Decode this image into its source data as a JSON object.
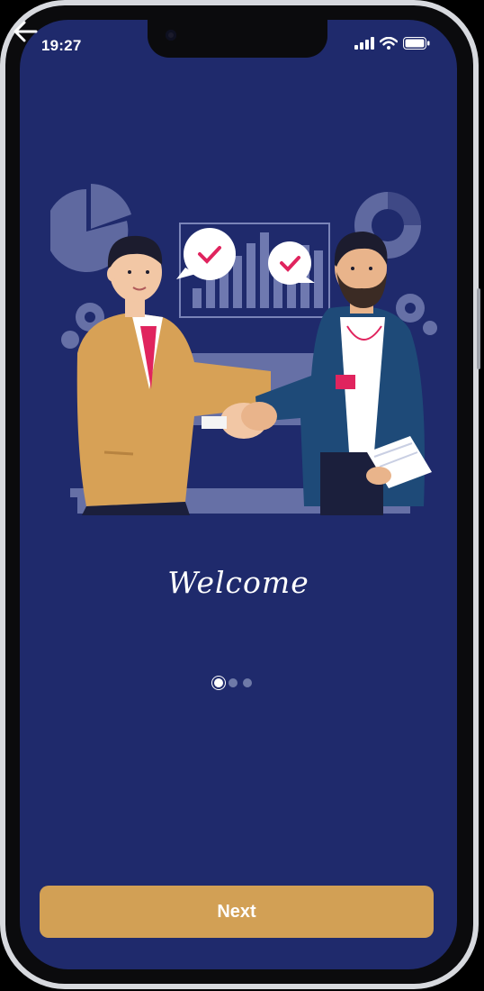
{
  "status_bar": {
    "time": "19:27",
    "icons": [
      "cellular-signal-icon",
      "wifi-icon",
      "battery-icon"
    ]
  },
  "navigation": {
    "back_icon": "back-arrow-icon"
  },
  "onboarding": {
    "illustration": "handshake-illustration",
    "title": "Welcome",
    "pagination": {
      "current_page": 1,
      "total_pages": 3
    },
    "next_button_label": "Next"
  },
  "colors": {
    "background": "#1f2a6c",
    "accent": "#d2a055",
    "text": "#ffffff",
    "inactive_dot": "#6f7aa8"
  }
}
